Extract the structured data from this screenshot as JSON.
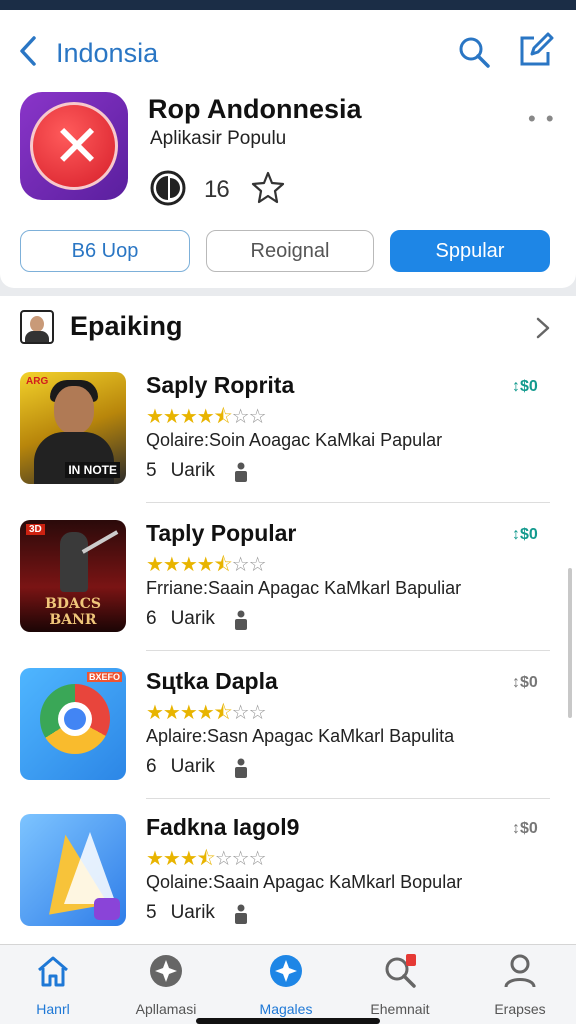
{
  "nav": {
    "title": "Indonsia",
    "back_icon": "chevron-left-icon",
    "search_icon": "search-icon",
    "edit_icon": "edit-icon"
  },
  "app": {
    "name": "Rop Andonnesia",
    "subtitle": "Aplikasir Populu",
    "meta_number": "16",
    "icon": "x-mark-app-icon",
    "badge_icon": "circle-badge-icon",
    "star_icon": "star-outline-icon"
  },
  "buttons": {
    "left": "B6 Uop",
    "middle": "Reoignal",
    "right": "Sppular"
  },
  "section": {
    "title": "Epaiking",
    "avatar_icon": "avatar-icon",
    "chevron_icon": "chevron-right-icon"
  },
  "items": [
    {
      "name": "Saply Roprita",
      "price": "↕$0",
      "rating": 4.5,
      "desc": "Qolaire:Soin Aoagac KaMkai Papular",
      "rank": "5",
      "rank_label": "Uarik"
    },
    {
      "name": "Taply Popular",
      "price": "↕$0",
      "rating": 4.5,
      "desc": "Frriane:Saain Apagac KaMkarl Bapulіar",
      "rank": "6",
      "rank_label": "Uarik"
    },
    {
      "name": "Sцtka Dapla",
      "price": "↕$0",
      "rating": 4.5,
      "desc": "Aplaire:Sasn Apagac KaMkarl Bapulіta",
      "rank": "6",
      "rank_label": "Uarik"
    },
    {
      "name": "Fadkna Iagol9",
      "price": "↕$0",
      "rating": 3.5,
      "desc": "Qolaine:Saain Apagac KaMkarl Bopular",
      "rank": "5",
      "rank_label": "Uarik"
    }
  ],
  "thumb_text": {
    "t1_tag": "ARG",
    "t1_corner": "IN NOTE",
    "t2_tag": "3D",
    "t2_title": "BDACS BANR",
    "t3_tag": "BXEFO"
  },
  "tabs": [
    {
      "label": "Hanrl",
      "icon": "home-icon"
    },
    {
      "label": "Apllamasi",
      "icon": "compass-icon"
    },
    {
      "label": "Magales",
      "icon": "compass-active-icon"
    },
    {
      "label": "Ehemnait",
      "icon": "search-badge-icon"
    },
    {
      "label": "Erapses",
      "icon": "person-icon"
    }
  ],
  "colors": {
    "accent": "#1e86e6",
    "brand_purple": "#7a2fc0",
    "price_teal": "#139a8e",
    "star": "#e8b400"
  }
}
